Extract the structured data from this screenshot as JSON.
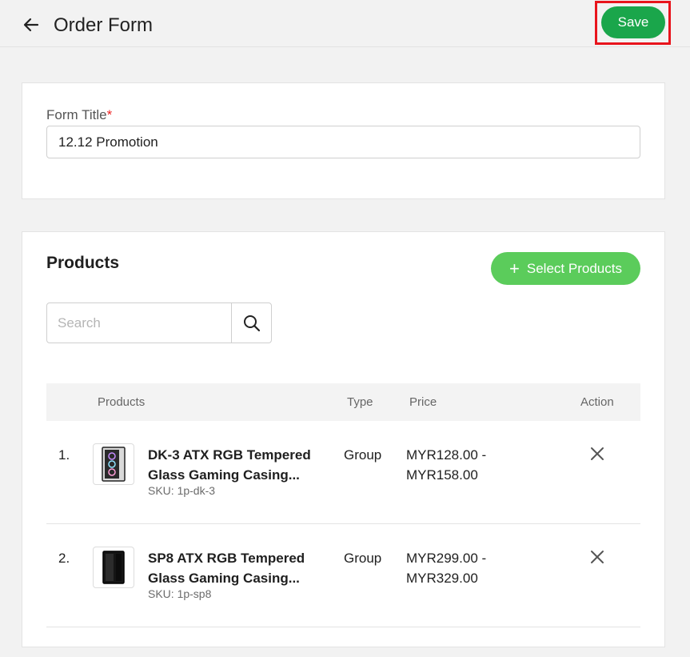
{
  "header": {
    "back_icon": "arrow-left-icon",
    "title": "Order Form",
    "save_label": "Save",
    "save_highlight_color": "#e8141c",
    "save_color": "#1aa64b"
  },
  "form": {
    "label": "Form Title",
    "required_mark": "*",
    "value": "12.12 Promotion"
  },
  "products": {
    "heading": "Products",
    "select_label": "Select Products",
    "select_color": "#5bcc5b",
    "search_placeholder": "Search",
    "search_icon": "search-icon",
    "columns": {
      "products": "Products",
      "type": "Type",
      "price": "Price",
      "action": "Action"
    },
    "rows": [
      {
        "index": "1.",
        "name": "DK-3 ATX RGB Tempered Glass Gaming Casing...",
        "sku": "SKU: 1p-dk-3",
        "type": "Group",
        "price": "MYR128.00 - MYR158.00",
        "action_icon": "close-icon"
      },
      {
        "index": "2.",
        "name": "SP8 ATX RGB Tempered Glass Gaming Casing...",
        "sku": "SKU: 1p-sp8",
        "type": "Group",
        "price": "MYR299.00 - MYR329.00",
        "action_icon": "close-icon"
      }
    ]
  }
}
